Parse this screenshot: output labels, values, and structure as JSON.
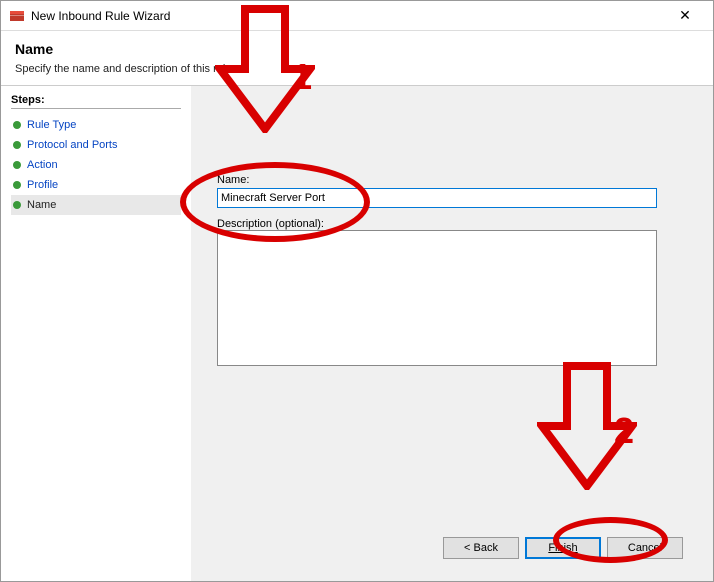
{
  "window": {
    "title": "New Inbound Rule Wizard"
  },
  "header": {
    "heading": "Name",
    "subtext": "Specify the name and description of this rule."
  },
  "sidebar": {
    "title": "Steps:",
    "items": [
      {
        "label": "Rule Type"
      },
      {
        "label": "Protocol and Ports"
      },
      {
        "label": "Action"
      },
      {
        "label": "Profile"
      },
      {
        "label": "Name"
      }
    ]
  },
  "form": {
    "name_label": "Name:",
    "name_value": "Minecraft Server Port",
    "description_label": "Description (optional):",
    "description_value": ""
  },
  "buttons": {
    "back": "< Back",
    "finish": "Finish",
    "cancel": "Cancel"
  },
  "annotations": {
    "step1": "1",
    "step2": "2"
  }
}
